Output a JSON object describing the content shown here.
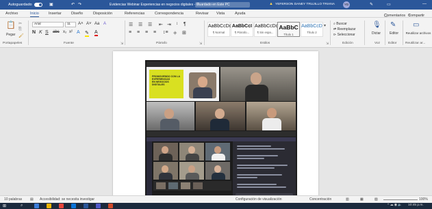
{
  "titlebar": {
    "autosave": "Autoguardado",
    "doc_title": "Evidencias Webinar Experiencias en negocios digitales - Guardado en Este PC",
    "user_name": "YEFERSON DANEY TRUJILLO TRIANA",
    "user_initials": "YD"
  },
  "menu": [
    "Archivo",
    "Inicio",
    "Insertar",
    "Diseño",
    "Disposición",
    "Referencias",
    "Correspondencia",
    "Revisar",
    "Vista",
    "Ayuda"
  ],
  "menu_right": {
    "comments": "Comentarios",
    "share": "Compartir"
  },
  "ribbon": {
    "paste": "Pegar",
    "font_name": "Arial",
    "font_size": "11",
    "styles": [
      {
        "preview": "AaBbCcDc",
        "name": "¶ Normal",
        "selected": false
      },
      {
        "preview": "AaBbCcI",
        "name": "¶ Párrafo...",
        "selected": false
      },
      {
        "preview": "AaBbCcDc",
        "name": "¶ Sin espa...",
        "selected": false
      },
      {
        "preview": "AaBbC",
        "name": "Título 1",
        "selected": true
      },
      {
        "preview": "AaBbCcD",
        "name": "Título 2",
        "selected": false
      }
    ],
    "edit": {
      "find": "Buscar",
      "replace": "Reemplazar",
      "select": "Seleccionar"
    },
    "dictate": "Dictar",
    "editor": "Editor",
    "reuse": "Reutilizar archivos",
    "groups": {
      "clipboard": "Portapapeles",
      "font": "Fuente",
      "paragraph": "Párrafo",
      "styles": "Estilos",
      "editing": "Edición",
      "voice": "Voz",
      "editor": "Editor",
      "reuse": "Reutilizar ar..."
    }
  },
  "status": {
    "page": "10 palabras",
    "accessibility": "Accesibilidad: se necesita investigar",
    "display": "Configuración de visualización",
    "focus": "Concentración",
    "zoom": "100%"
  },
  "taskbar": {
    "clock": "10:45 p.m.",
    "weather": "ESP"
  },
  "embedded": {
    "slide_line1": "PROMOVIENDO CON LA",
    "slide_line2": "EXPERIENCIAS",
    "slide_line3": "EN NEGOCIOS",
    "slide_line4": "DIGITALES"
  },
  "colors": {
    "word_blue": "#2b579a",
    "taskbar": "#1b2a3d",
    "slide_yellow": "#d9e021"
  }
}
